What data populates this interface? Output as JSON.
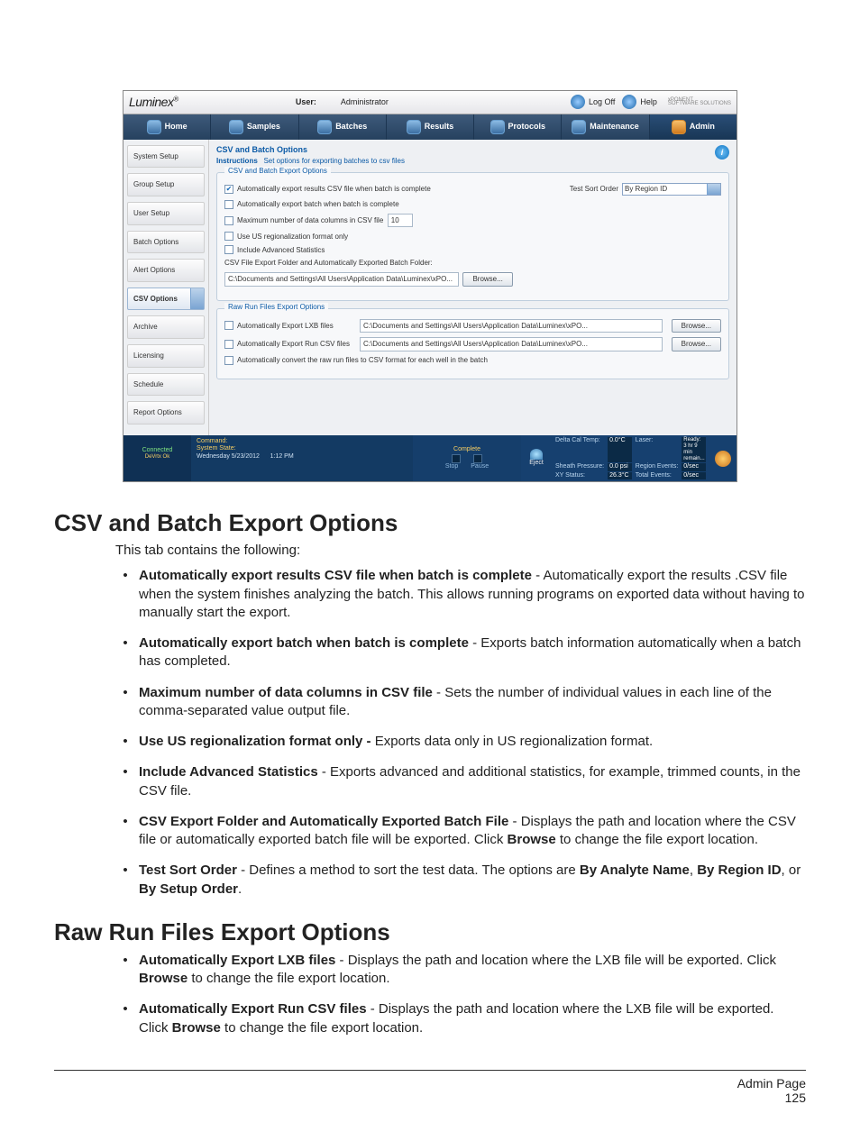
{
  "brand": "Luminex",
  "hdr": {
    "user_lbl": "User:",
    "user_val": "Administrator",
    "logoff": "Log Off",
    "help": "Help",
    "prod": "xPONENT",
    "prod_sub": "SOFTWARE SOLUTIONS"
  },
  "tabs": {
    "home": "Home",
    "samples": "Samples",
    "batches": "Batches",
    "results": "Results",
    "protocols": "Protocols",
    "maintenance": "Maintenance",
    "admin": "Admin"
  },
  "left": {
    "system": "System Setup",
    "group": "Group Setup",
    "user": "User Setup",
    "batch": "Batch Options",
    "alert": "Alert Options",
    "csv": "CSV Options",
    "archive": "Archive",
    "licensing": "Licensing",
    "schedule": "Schedule",
    "report": "Report Options"
  },
  "panel": {
    "title": "CSV and Batch Options",
    "instr_lbl": "Instructions",
    "instr_txt": "Set options for exporting batches to csv files",
    "fs1": {
      "legend": "CSV and Batch Export Options",
      "auto_csv": "Automatically export results CSV file when batch is complete",
      "sort_lbl": "Test Sort Order",
      "sort_val": "By Region ID",
      "auto_batch": "Automatically export batch when batch is complete",
      "maxcols": "Maximum number of data columns in CSV file",
      "maxcols_val": "10",
      "usfmt": "Use US regionalization format only",
      "advstats": "Include Advanced Statistics",
      "folder_lbl": "CSV File Export Folder and Automatically Exported Batch Folder:",
      "folder_val": "C:\\Documents and Settings\\All Users\\Application Data\\Luminex\\xPO...",
      "browse": "Browse..."
    },
    "fs2": {
      "legend": "Raw Run Files Export Options",
      "lxb": "Automatically Export LXB files",
      "lxb_path": "C:\\Documents and Settings\\All Users\\Application Data\\Luminex\\xPO...",
      "runcsv": "Automatically Export Run CSV files",
      "runcsv_path": "C:\\Documents and Settings\\All Users\\Application Data\\Luminex\\xPO...",
      "convert": "Automatically convert the raw run files to CSV format for each well in the batch",
      "browse": "Browse..."
    }
  },
  "status": {
    "connected": "Connected",
    "device": "DeVrtx Ok",
    "command": "Command:",
    "sysstate": "System State:",
    "date": "Wednesday 5/23/2012",
    "time": "1:12 PM",
    "complete": "Complete",
    "stop": "Stop",
    "pause": "Pause",
    "eject": "Eject",
    "dct": "Delta Cal Temp:",
    "dct_v": "0.0°C",
    "sp": "Sheath Pressure:",
    "sp_v": "0.0 psi",
    "xy": "XY Status:",
    "xy_v": "26.3°C",
    "laser": "Laser:",
    "laser_v": "Ready: 3 hr 9 min remain...",
    "re": "Region Events:",
    "re_v": "0/sec",
    "te": "Total Events:",
    "te_v": "0/sec"
  },
  "doc": {
    "h1": "CSV and Batch Export Options",
    "intro": "This tab contains the following:",
    "items": [
      {
        "b": "Automatically export results CSV file when batch is complete",
        "t": " - Automatically export the results .CSV file when the system finishes analyzing the batch. This allows running programs on exported data without having to manually start the export."
      },
      {
        "b": "Automatically export batch when batch is complete",
        "t": " - Exports batch information automatically when a batch has completed."
      },
      {
        "b": "Maximum number of data columns in CSV file",
        "t": " - Sets the number of individual values in each line of the comma-separated value output file."
      },
      {
        "b": "Use US regionalization format only - ",
        "t": "Exports data only in US regionalization format."
      },
      {
        "b": "Include Advanced Statistics",
        "t": " - Exports advanced and additional statistics, for example, trimmed counts, in the CSV file."
      },
      {
        "html": "<b>CSV Export Folder and Automatically Exported Batch File</b> - Displays the path and location where the CSV file or automatically exported batch file will be exported. Click <b>Browse</b> to change the file export location."
      },
      {
        "html": "<b>Test Sort Order</b> - Defines a method to sort the test data. The options are <b>By Analyte Name</b>, <b>By Region ID</b>, or <b>By Setup Order</b>."
      }
    ],
    "h2": "Raw Run Files Export Options",
    "items2": [
      {
        "html": "<b>Automatically Export LXB files</b> - Displays the path and location where the LXB file will be exported. Click <b>Browse</b> to change the file export location."
      },
      {
        "html": "<b>Automatically Export Run CSV files</b> - Displays the path and location where the LXB file will be exported. Click <b>Browse</b> to change the file export location."
      }
    ],
    "ftr1": "Admin Page",
    "ftr2": "125"
  }
}
